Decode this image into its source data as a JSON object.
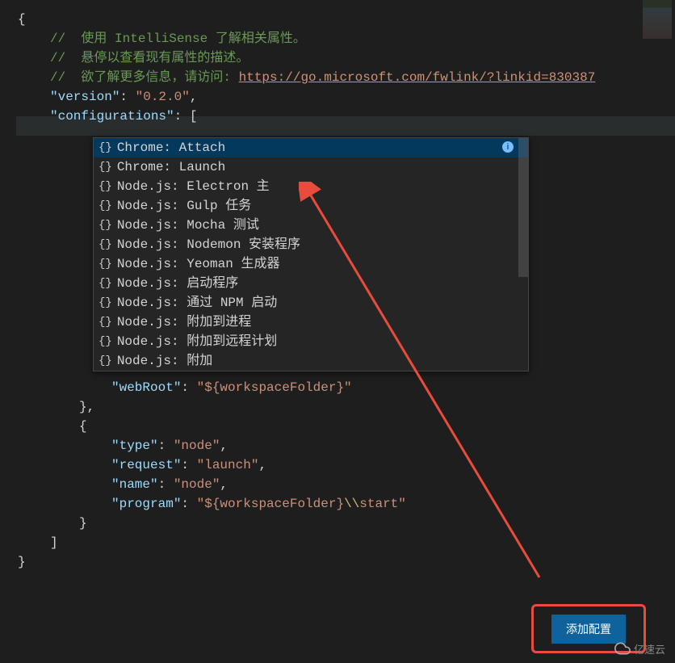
{
  "comments": {
    "c1": "//  使用 IntelliSense 了解相关属性。",
    "c2": "//  悬停以查看现有属性的描述。",
    "c3_prefix": "//  欲了解更多信息，请访问: ",
    "c3_link": "https://go.microsoft.com/fwlink/?linkid=830387"
  },
  "json": {
    "open_brace": "{",
    "version_key": "\"version\"",
    "version_val": "\"0.2.0\"",
    "configurations_key": "\"configurations\"",
    "open_bracket": "[",
    "webRoot_key": "\"webRoot\"",
    "webRoot_val": "\"${workspaceFolder}\"",
    "close_brace_comma": "},",
    "open_brace2": "{",
    "type_key": "\"type\"",
    "type_val": "\"node\"",
    "request_key": "\"request\"",
    "request_val": "\"launch\"",
    "name_key": "\"name\"",
    "name_val": "\"node\"",
    "program_key": "\"program\"",
    "program_val_pre": "\"${workspaceFolder}",
    "program_val_esc": "\\\\",
    "program_val_post": "start\"",
    "close_brace": "}",
    "close_bracket": "]",
    "final_close": "}",
    "colon": ": ",
    "comma": ","
  },
  "dropdown": {
    "icon": "{}",
    "items": [
      "Chrome: Attach",
      "Chrome: Launch",
      "Node.js: Electron 主",
      "Node.js: Gulp 任务",
      "Node.js: Mocha 测试",
      "Node.js: Nodemon 安装程序",
      "Node.js: Yeoman 生成器",
      "Node.js: 启动程序",
      "Node.js: 通过 NPM 启动",
      "Node.js: 附加到进程",
      "Node.js: 附加到远程计划",
      "Node.js: 附加"
    ],
    "info": "i"
  },
  "button": {
    "label": "添加配置"
  },
  "watermark": {
    "text": "亿速云"
  }
}
